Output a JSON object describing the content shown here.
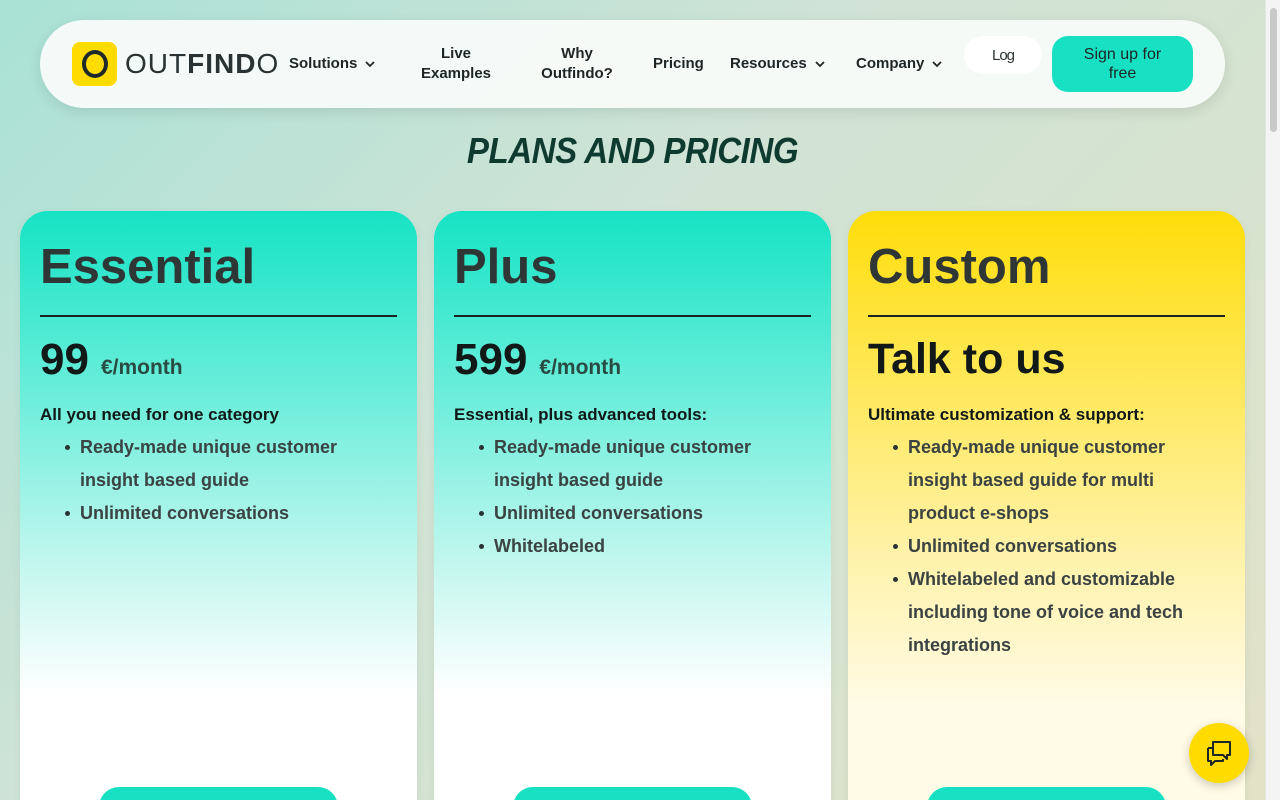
{
  "brand": {
    "name_light": "OUT",
    "name_bold": "FIND",
    "name_end": "O"
  },
  "nav": {
    "solutions": "Solutions",
    "live_examples": "Live Examples",
    "why": "Why Outfindo?",
    "pricing": "Pricing",
    "resources": "Resources",
    "company": "Company",
    "login": "Log",
    "signup": "Sign up for free"
  },
  "page_title": "PLANS AND PRICING",
  "plans": [
    {
      "name": "Essential",
      "price": "99",
      "unit": "€/month",
      "tagline": "All you need for one category",
      "features": [
        "Ready-made unique customer insight based guide",
        "Unlimited conversations"
      ]
    },
    {
      "name": "Plus",
      "price": "599",
      "unit": "€/month",
      "tagline": "Essential, plus advanced tools:",
      "features": [
        "Ready-made unique customer insight based guide",
        "Unlimited conversations",
        "Whitelabeled"
      ]
    },
    {
      "name": "Custom",
      "price": "Talk to us",
      "unit": "",
      "tagline": "Ultimate customization & support:",
      "features": [
        "Ready-made unique customer insight based guide for multi product e-shops",
        "Unlimited conversations",
        "Whitelabeled and customizable including tone of voice and tech integrations"
      ]
    }
  ],
  "colors": {
    "accent_teal": "#18e0c2",
    "accent_yellow": "#ffdb00",
    "title": "#0f3a30"
  },
  "icons": {
    "chat": "chat-bubbles-icon",
    "dropdown": "chevron-down-icon"
  }
}
